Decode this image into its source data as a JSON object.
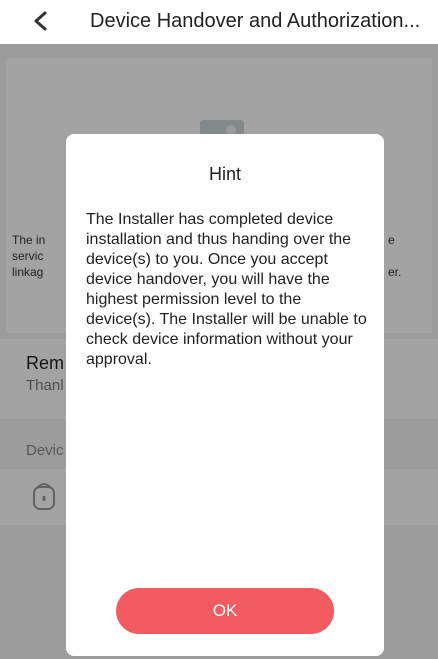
{
  "header": {
    "title": "Device Handover and Authorization..."
  },
  "background": {
    "hero_left_lines": [
      "The in",
      "servic",
      "linkag"
    ],
    "hero_right_lines": [
      "e",
      "",
      "er."
    ],
    "remark_title": "Rem",
    "remark_sub": "Thanl",
    "device_label": "Devic"
  },
  "dialog": {
    "title": "Hint",
    "message": "The Installer has completed device installation and thus handing over the device(s) to you. Once you accept device handover, you will have the highest permission level to the device(s). The Installer will be unable to check device information without your approval.",
    "ok_label": "OK"
  },
  "colors": {
    "accent": "#f25c61",
    "overlay": "rgba(0,0,0,0.36)"
  },
  "icons": [
    "back-icon",
    "image-placeholder-icon",
    "device-icon"
  ]
}
